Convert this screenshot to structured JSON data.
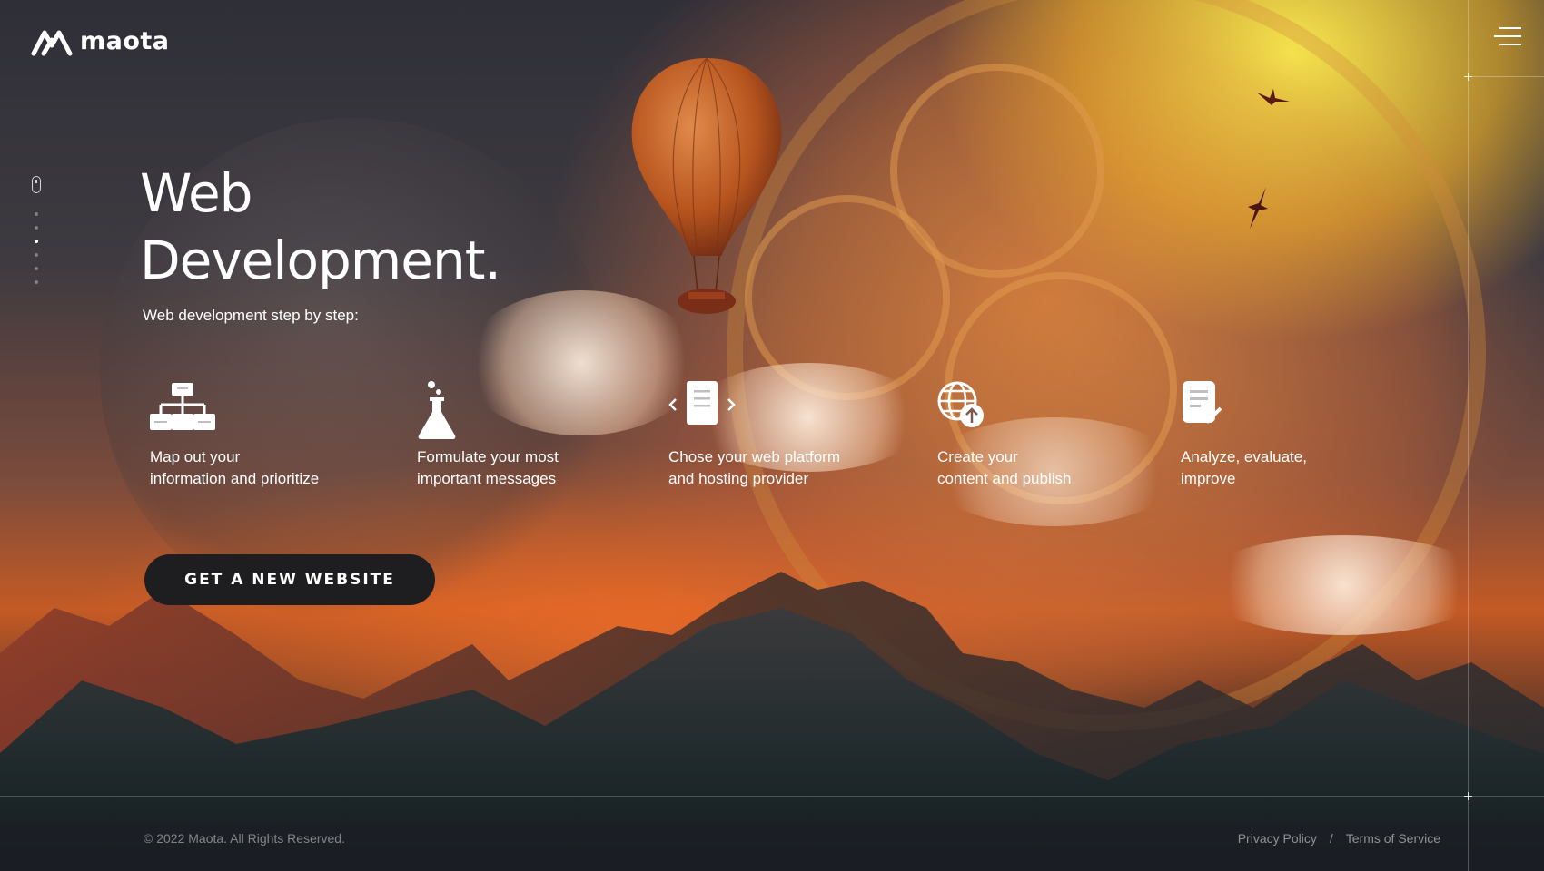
{
  "brand": {
    "name": "maota",
    "logo_icon": "maota-logo-icon"
  },
  "nav": {
    "menu_icon": "hamburger-menu-icon"
  },
  "hero": {
    "title_line1": "Web",
    "title_line2": "Development.",
    "subtitle": "Web development step by step:"
  },
  "steps": [
    {
      "icon": "sitemap-icon",
      "line1": "Map out your",
      "line2": "information and prioritize"
    },
    {
      "icon": "flask-icon",
      "line1": "Formulate your most",
      "line2": "important messages"
    },
    {
      "icon": "document-code-icon",
      "line1": "Chose your web platform",
      "line2": "and hosting provider"
    },
    {
      "icon": "globe-upload-icon",
      "line1": "Create your",
      "line2": "content and publish"
    },
    {
      "icon": "document-check-icon",
      "line1": "Analyze, evaluate,",
      "line2": "improve"
    }
  ],
  "cta": {
    "label": "GET A NEW WEBSITE"
  },
  "pager": {
    "count": 6,
    "active_index": 2
  },
  "footer": {
    "copyright": "© 2022 Maota. All Rights Reserved.",
    "privacy": "Privacy Policy",
    "separator": "/",
    "terms": "Terms of Service"
  }
}
